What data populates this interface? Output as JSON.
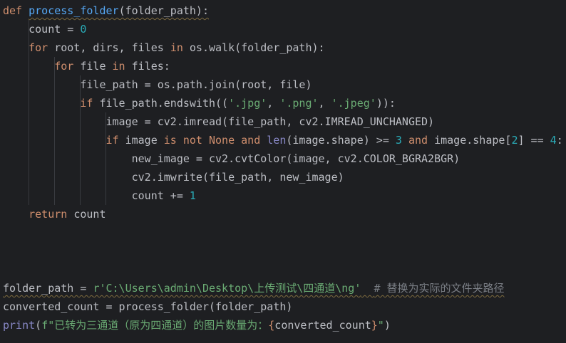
{
  "colors": {
    "background": "#1e1f22",
    "text": "#bcbec4",
    "keyword": "#cf8e6d",
    "function": "#56a8f5",
    "builtin": "#8888c6",
    "number": "#2aacb8",
    "string": "#6aab73",
    "comment": "#7a7e85"
  },
  "code": {
    "l1": {
      "kw_def": "def ",
      "fn_name": "process_folder",
      "rest": "(folder_path):"
    },
    "l2": {
      "text": "count = ",
      "num": "0"
    },
    "l3": {
      "kw_for": "for ",
      "a": "root, dirs, files ",
      "kw_in": "in ",
      "b": "os.walk(folder_path):"
    },
    "l4": {
      "kw_for": "for ",
      "a": "file ",
      "kw_in": "in ",
      "b": "files:"
    },
    "l5": {
      "text": "file_path = os.path.join(root, file)"
    },
    "l6": {
      "kw_if": "if ",
      "a": "file_path.endswith((",
      "s1": "'.jpg'",
      "c1": ", ",
      "s2": "'.png'",
      "c2": ", ",
      "s3": "'.jpeg'",
      "b": ")):"
    },
    "l7": {
      "text": "image = cv2.imread(file_path, cv2.IMREAD_UNCHANGED)"
    },
    "l8": {
      "kw_if": "if ",
      "a": "image ",
      "kw_is": "is ",
      "kw_not": "not ",
      "kw_none": "None ",
      "kw_and": "and ",
      "bi_len": "len",
      "b": "(image.shape) >= ",
      "n3": "3",
      "c": " ",
      "kw_and2": "and ",
      "d": "image.shape[",
      "n2": "2",
      "e": "] == ",
      "n4": "4",
      "f": ":"
    },
    "l9": {
      "text": "new_image = cv2.cvtColor(image, cv2.COLOR_BGRA2BGR)"
    },
    "l10": {
      "text": "cv2.imwrite(file_path, new_image)"
    },
    "l11": {
      "text": "count += ",
      "num": "1"
    },
    "l12": {
      "kw_return": "return ",
      "text": "count"
    },
    "l13": {
      "a": "folder_path = ",
      "str": "r'C:\\Users\\admin\\Desktop\\上传测试\\四通道\\ng'",
      "sp": "  ",
      "cmt": "# 替换为实际的文件夹路径"
    },
    "l14": {
      "text": "converted_count = process_folder(folder_path)"
    },
    "l15": {
      "bi_print": "print",
      "a": "(",
      "fstr_a": "f\"已转为三通道（原为四通道）的图片数量为：",
      "brace_open": "{",
      "var": "converted_count",
      "brace_close": "}",
      "fstr_b": "\"",
      "b": ")"
    }
  }
}
